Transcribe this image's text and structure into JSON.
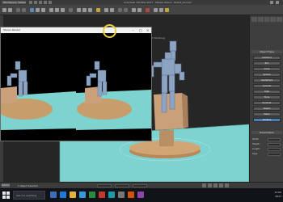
{
  "app": {
    "title": "Autodesk 3ds Max 2017 - Marker Robot - Robot_AS.max",
    "workspace_label": "Workspace: Default",
    "viewport_label": "[+] [Perspective] [Standard] [Default Shading]"
  },
  "render_window": {
    "title": "Stereo Render",
    "minimize_glyph": "–",
    "maximize_glyph": "□",
    "close_glyph": "×"
  },
  "command_panel": {
    "heading": "Object Type",
    "object_buttons": [
      "AutoGrid",
      "Box",
      "Cone",
      "Sphere",
      "GeoSphere",
      "Cylinder",
      "Tube",
      "Torus",
      "Pyramid",
      "Teapot",
      "Plane",
      "TextPlus"
    ],
    "active_index": 11,
    "parameters_heading": "Parameters",
    "fields": [
      {
        "label": "Width:"
      },
      {
        "label": "Height:"
      },
      {
        "label": "Length:"
      },
      {
        "label": "Segs:"
      }
    ]
  },
  "status": {
    "maxscript": "MAXScript",
    "selection": "1 Object Selected"
  },
  "taskbar": {
    "search_placeholder": "Ask me anything",
    "time": "12:00",
    "date": "2017"
  },
  "colors": {
    "accent": "#e6cf3f",
    "active_button": "#4f7fb8",
    "floor": "#7dd3cf",
    "robot": "#8da3c2",
    "base": "#c89d6c"
  }
}
